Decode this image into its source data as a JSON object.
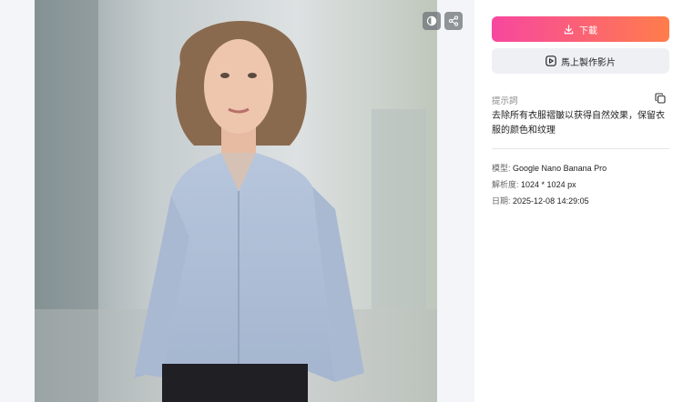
{
  "actions": {
    "download_label": "下載",
    "make_video_label": "馬上製作影片"
  },
  "prompt": {
    "label": "提示詞",
    "text": "去除所有衣服褶皺以获得自然效果，保留衣服的颜色和纹理"
  },
  "meta": {
    "model_label": "模型:",
    "model_value": "Google Nano Banana Pro",
    "resolution_label": "解析度:",
    "resolution_value": "1024 * 1024 px",
    "date_label": "日期:",
    "date_value": "2025-12-08 14:29:05"
  },
  "colors": {
    "download_gradient_start": "#f7479f",
    "download_gradient_end": "#ff7d4b",
    "secondary_button_bg": "#eff0f4"
  },
  "icons": {
    "compare": "compare-icon",
    "share": "share-icon",
    "download": "download-icon",
    "video": "play-video-icon",
    "copy": "copy-icon"
  }
}
